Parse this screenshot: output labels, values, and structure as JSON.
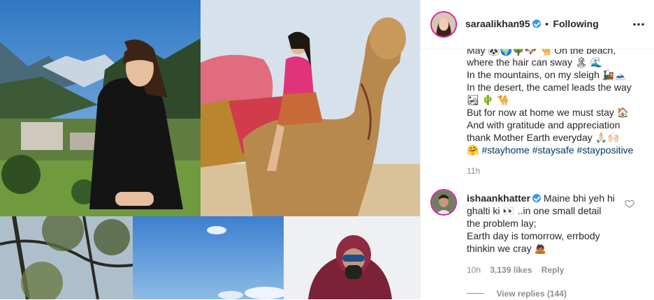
{
  "post": {
    "username": "saraalikhan95",
    "follow_status": "Following",
    "caption_lines": [
      "May 🐼🌍🌳🐶 🐪 On the beach,",
      "where the hair can sway 🏝 🌊",
      "In the mountains, on my sleigh 🚂🗻",
      "In the desert, the camel leads the way",
      "🏜 🌵 🐪",
      "But for now at home we must stay 🏠",
      "And with gratitude and appreciation",
      "thank Mother Earth everyday 🙏🏻🙌🏻"
    ],
    "caption_last_emoji": "🤗",
    "hashtags": [
      "#stayhome",
      "#staysafe",
      "#staypositive"
    ],
    "time": "11h"
  },
  "comment": {
    "username": "ishaankhatter",
    "lines": [
      "Maine bhi yeh hi",
      "ghalti ki 👀 ..in one small detail",
      "the problem lay;",
      "Earth day is tomorrow, errbody",
      "thinkin we cray 🙇🏽"
    ],
    "time": "10h",
    "likes": "3,139 likes",
    "reply": "Reply",
    "view_replies": "View replies (144)"
  },
  "colors": {
    "verified": "#3897f0",
    "hashtag": "#00376b",
    "meta": "#8e8e8e",
    "avatar_ring": "#d6249f"
  },
  "icons": {
    "more": "more-options-icon",
    "like": "heart-icon"
  }
}
